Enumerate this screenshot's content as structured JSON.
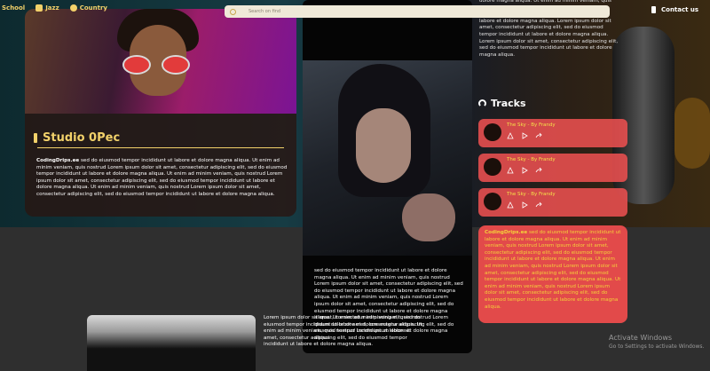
{
  "nav": {
    "links": [
      {
        "label": "School",
        "icon": "school-icon"
      },
      {
        "label": "Jazz",
        "icon": "jazz-icon"
      },
      {
        "label": "Country",
        "icon": "headphones-icon"
      }
    ],
    "search_placeholder": "Search on find",
    "contact_label": "Contact us"
  },
  "studio": {
    "title": "Studio 0Pec",
    "text_brand": "CodingDrips.ee",
    "text_body": "sed do eiusmod tempor incididunt ut labore et dolore magna aliqua. Ut enim ad minim veniam, quis nostrud Lorem ipsum dolor sit amet, consectetur adipiscing elit, sed do eiusmod tempor incididunt ut labore et dolore magna aliqua. Ut enim ad minim veniam, quis nostrud Lorem ipsum dolor sit amet, consectetur adipiscing elit, sed do eiusmod tempor incididunt ut labore et dolore magna aliqua. Ut enim ad minim veniam, quis nostrud Lorem ipsum dolor sit amet, consectetur adipiscing elit, sed do eiusmod tempor incididunt ut labore et dolore magna aliqua."
  },
  "center": {
    "text": "sed do eiusmod tempor incididunt ut labore et dolore magna aliqua. Ut enim ad minim veniam, quis nostrud Lorem ipsum dolor sit amet, consectetur adipiscing elit, sed do eiusmod tempor incididunt ut labore et dolore magna aliqua. Ut enim ad minim veniam, quis nostrud Lorem ipsum dolor sit amet, consectetur adipiscing elit, sed do eiusmod tempor incididunt ut labore et dolore magna aliqua. Ut enim ad minim veniam, quis nostrud Lorem ipsum dolor sit amet, consectetur adipiscing elit, sed do eiusmod tempor incididunt ut labore et dolore magna aliqua."
  },
  "top_right": {
    "text": "dolore magna aliqua. Ut enim ad minim veniam, quis nostrud Lorem ipsum dolor sit amet, consectetur adipiscing elit, sed do eiusmod tempor incididunt ut labore et dolore magna aliqua. Lorem ipsum dolor sit amet, consectetur adipiscing elit, sed do eiusmod tempor incididunt ut labore et dolore magna aliqua. Lorem ipsum dolor sit amet, consectetur adipiscing elit, sed do eiusmod tempor incididunt ut labore et dolore magna aliqua."
  },
  "tracks": {
    "title": "Tracks",
    "items": [
      {
        "title": "The Sky - By Frandy"
      },
      {
        "title": "The Sky - By Frandy"
      },
      {
        "title": "The Sky - By Frandy"
      }
    ]
  },
  "coral": {
    "brand": "CodingDrips.ee",
    "text": "sed do eiusmod tempor incididunt ut labore et dolore magna aliqua. Ut enim ad minim veniam, quis nostrud Lorem ipsum dolor sit amet, consectetur adipiscing elit, sed do eiusmod tempor incididunt ut labore et dolore magna aliqua. Ut enim ad minim veniam, quis nostrud Lorem ipsum dolor sit amet, consectetur adipiscing elit, sed do eiusmod tempor incididunt ut labore et dolore magna aliqua. Ut enim ad minim veniam, quis nostrud Lorem ipsum dolor sit amet, consectetur adipiscing elit, sed do eiusmod tempor incididunt ut labore et dolore magna aliqua."
  },
  "bottom_left": {
    "text": "Lorem ipsum dolor sit amet, consectetur adipiscing elit, sed do eiusmod tempor incididunt ut labore et dolore magna aliqua. Ut enim ad minim veniam, quis nostrud Lorem ipsum dolor sit amet, consectetur adipiscing elit, sed do eiusmod tempor incididunt ut labore et dolore magna aliqua."
  },
  "watermark": {
    "title": "Activate Windows",
    "subtitle": "Go to Settings to activate Windows."
  },
  "colors": {
    "accent": "#f2d16a",
    "track_bg": "#e24a4a",
    "coral_text": "#f5d13a"
  }
}
